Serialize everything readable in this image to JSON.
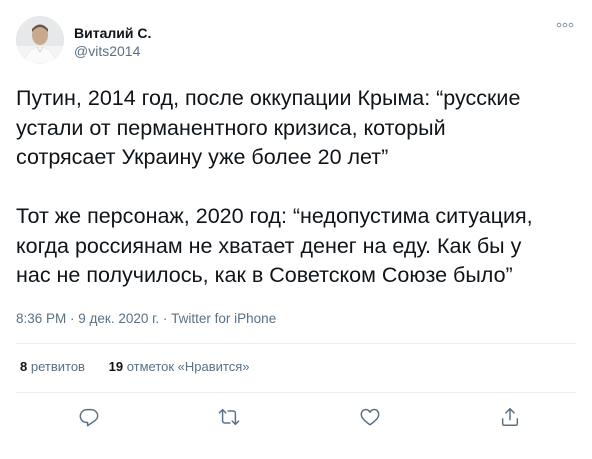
{
  "user": {
    "display_name": "Виталий С.",
    "handle": "@vits2014"
  },
  "tweet": {
    "text": "Путин, 2014 год, после оккупации Крыма: “русские\nустали от перманентного кризиса, который\nсотрясает Украину уже более 20 лет”\n\nТот же персонаж, 2020 год: “недопустима ситуация,\nкогда россиянам не хватает денег на еду. Как бы у\nнас не получилось, как в Советском Союзе было”",
    "time": "8:36 PM",
    "separator1": " · ",
    "date": "9 дек. 2020 г.",
    "separator2": " · ",
    "source": "Twitter for iPhone"
  },
  "stats": {
    "retweets_count": "8",
    "retweets_label": "ретвитов",
    "likes_count": "19",
    "likes_label": "отметок «Нравится»"
  },
  "icons": {
    "more": "more-dots-icon",
    "reply": "reply-icon",
    "retweet": "retweet-icon",
    "like": "heart-icon",
    "share": "share-icon"
  },
  "colors": {
    "text": "#0f1419",
    "secondary": "#5b7083",
    "divider": "#ebeef0"
  }
}
